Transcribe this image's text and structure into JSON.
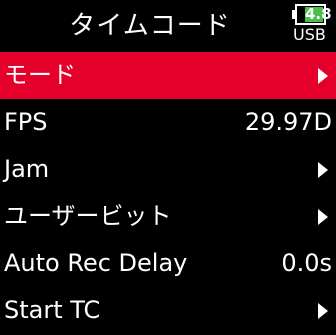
{
  "header": {
    "title": "タイムコード",
    "battery_level": "4.8",
    "power_source": "USB",
    "battery_color": "#4bbd4b"
  },
  "accent_color": "#e4002b",
  "menu": [
    {
      "label": "モード",
      "value": null,
      "icon": "chevron-right-icon",
      "selected": true
    },
    {
      "label": "FPS",
      "value": "29.97D",
      "selected": false
    },
    {
      "label": "Jam",
      "value": null,
      "icon": "chevron-right-icon",
      "selected": false
    },
    {
      "label": "ユーザービット",
      "value": null,
      "icon": "chevron-right-icon",
      "selected": false
    },
    {
      "label": "Auto Rec Delay",
      "value": "0.0s",
      "selected": false
    },
    {
      "label": "Start TC",
      "value": null,
      "icon": "chevron-right-icon",
      "selected": false
    }
  ]
}
